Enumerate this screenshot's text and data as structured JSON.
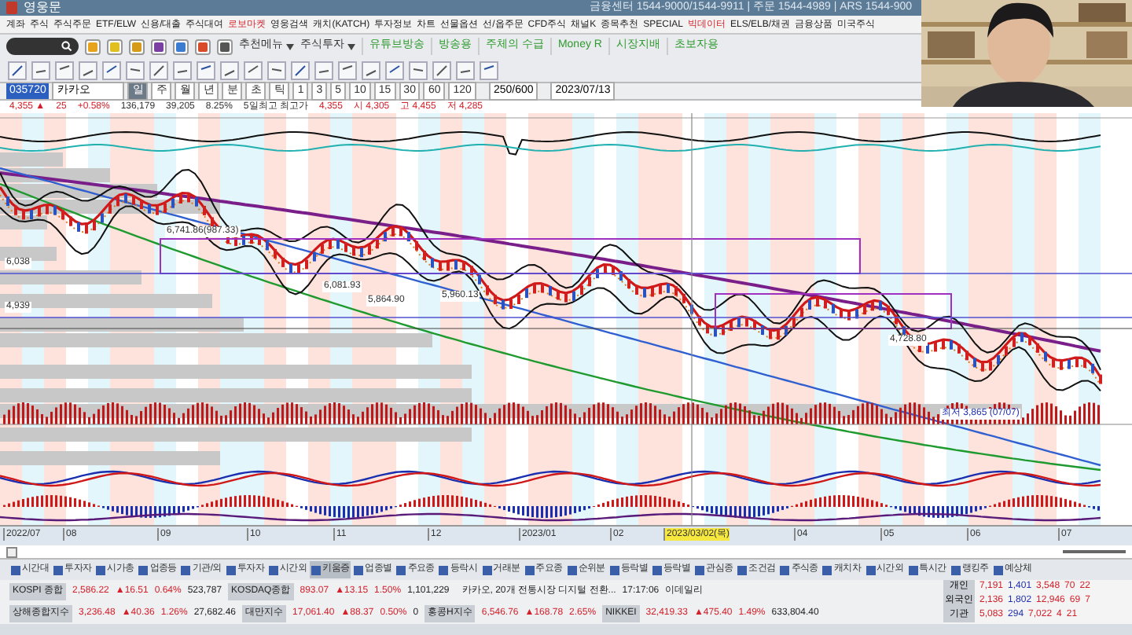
{
  "window": {
    "title": "영웅문",
    "info": "금융센터 1544-9000/1544-9911  |  주문 1544-4989  |  ARS 1544-900"
  },
  "menu": [
    {
      "label": "계좌",
      "highlighted": false
    },
    {
      "label": "주식",
      "highlighted": false
    },
    {
      "label": "주식주문",
      "highlighted": false
    },
    {
      "label": "ETF/ELW",
      "highlighted": false
    },
    {
      "label": "신용/대출",
      "highlighted": false
    },
    {
      "label": "주식대여",
      "highlighted": false
    },
    {
      "label": "로보마켓",
      "highlighted": true
    },
    {
      "label": "영웅검색",
      "highlighted": false
    },
    {
      "label": "캐치(KATCH)",
      "highlighted": false
    },
    {
      "label": "투자정보",
      "highlighted": false
    },
    {
      "label": "차트",
      "highlighted": false
    },
    {
      "label": "선물옵션",
      "highlighted": false
    },
    {
      "label": "선/옵주문",
      "highlighted": false
    },
    {
      "label": "CFD주식",
      "highlighted": false
    },
    {
      "label": "채널K",
      "highlighted": false
    },
    {
      "label": "종목추천",
      "highlighted": false
    },
    {
      "label": "SPECIAL",
      "highlighted": false
    },
    {
      "label": "빅데이터",
      "highlighted": true
    },
    {
      "label": "ELS/ELB/채권",
      "highlighted": false
    },
    {
      "label": "금융상품",
      "highlighted": false
    },
    {
      "label": "미국주식",
      "highlighted": false
    }
  ],
  "toolbar": {
    "dropdowns": [
      "추천메뉴",
      "주식투자"
    ],
    "links": [
      "유튜브방송",
      "방송용",
      "주체의 수급",
      "Money R",
      "시장지배",
      "초보자용"
    ]
  },
  "chart_toolbar": {
    "code": "035720",
    "name": "카카오",
    "periods": [
      {
        "label": "일",
        "selected": true
      },
      {
        "label": "주",
        "selected": false
      },
      {
        "label": "월",
        "selected": false
      },
      {
        "label": "년",
        "selected": false
      },
      {
        "label": "분",
        "selected": false
      },
      {
        "label": "초",
        "selected": false
      },
      {
        "label": "틱",
        "selected": false
      },
      {
        "label": "1",
        "selected": false
      },
      {
        "label": "3",
        "selected": false
      },
      {
        "label": "5",
        "selected": false
      },
      {
        "label": "10",
        "selected": false
      },
      {
        "label": "15",
        "selected": false
      },
      {
        "label": "30",
        "selected": false
      },
      {
        "label": "60",
        "selected": false
      },
      {
        "label": "120",
        "selected": false
      }
    ],
    "count": "250/600",
    "date": "2023/07/13"
  },
  "price_row": [
    "4,355 ▲",
    "25",
    "+0.58%",
    "136,179",
    "39,205",
    "8.25%",
    "5일최고 최고가",
    "4,355",
    "시 4,305",
    "고 4,455",
    "저 4,285"
  ],
  "chart": {
    "labels": [
      "6,741.86(987.33)",
      "6,038",
      "4,939",
      "6,081.93",
      "5,864.90",
      "5,960.13",
      "4,728.80",
      "최저 3,865 (07/07)"
    ],
    "dates": [
      "2022/07",
      "08",
      "09",
      "10",
      "11",
      "12",
      "2023/01",
      "02",
      "2023/03/02(목)",
      "04",
      "05",
      "06",
      "07"
    ]
  },
  "tabs": [
    {
      "label": "시간대",
      "selected": false
    },
    {
      "label": "투자자",
      "selected": false
    },
    {
      "label": "시가총",
      "selected": false
    },
    {
      "label": "업종등",
      "selected": false
    },
    {
      "label": "기관/외",
      "selected": false
    },
    {
      "label": "투자자",
      "selected": false
    },
    {
      "label": "시간외",
      "selected": false
    },
    {
      "label": "키움증",
      "selected": true
    },
    {
      "label": "업종별",
      "selected": false
    },
    {
      "label": "주요종",
      "selected": false
    },
    {
      "label": "등락시",
      "selected": false
    },
    {
      "label": "거래분",
      "selected": false
    },
    {
      "label": "주요종",
      "selected": false
    },
    {
      "label": "순위분",
      "selected": false
    },
    {
      "label": "등락별",
      "selected": false
    },
    {
      "label": "등락별",
      "selected": false
    },
    {
      "label": "관심종",
      "selected": false
    },
    {
      "label": "조건검",
      "selected": false
    },
    {
      "label": "주식종",
      "selected": false
    },
    {
      "label": "캐치차",
      "selected": false
    },
    {
      "label": "시간외",
      "selected": false
    },
    {
      "label": "특시간",
      "selected": false
    },
    {
      "label": "랭킹주",
      "selected": false
    },
    {
      "label": "예상체",
      "selected": false
    }
  ],
  "indices": [
    [
      {
        "name": "KOSPI 종합",
        "value": "2,586.22",
        "change": "▲16.51",
        "rate": "0.64%",
        "volume": "523,787"
      },
      {
        "name": "KOSDAQ종합",
        "value": "893.07",
        "change": "▲13.15",
        "rate": "1.50%",
        "volume": "1,101,229"
      }
    ],
    [
      {
        "name": "상해종합지수",
        "value": "3,236.48",
        "change": "▲40.36",
        "rate": "1.26%",
        "volume": "27,682.46"
      },
      {
        "name": "대만지수",
        "value": "17,061.40",
        "change": "▲88.37",
        "rate": "0.50%",
        "volume": "0"
      },
      {
        "name": "홍콩H지수",
        "value": "6,546.76",
        "change": "▲168.78",
        "rate": "2.65%"
      },
      {
        "name": "NIKKEI",
        "value": "32,419.33",
        "change": "▲475.40",
        "rate": "1.49%",
        "volume": "633,804.40"
      }
    ]
  ],
  "news": {
    "headline": "카카오, 20개 전통시장 디지털 전환...",
    "time": "17:17:06",
    "source": "이데일리"
  },
  "investors": [
    {
      "name": "개인",
      "values": [
        "7,191",
        "1,401",
        "3,548",
        "70",
        "22"
      ]
    },
    {
      "name": "외국인",
      "values": [
        "2,136",
        "1,802",
        "12,946",
        "69",
        "7"
      ]
    },
    {
      "name": "기관",
      "values": [
        "5,083",
        "294",
        "7,022",
        "4",
        "21"
      ]
    }
  ],
  "webcam": {
    "kind": "picture"
  }
}
